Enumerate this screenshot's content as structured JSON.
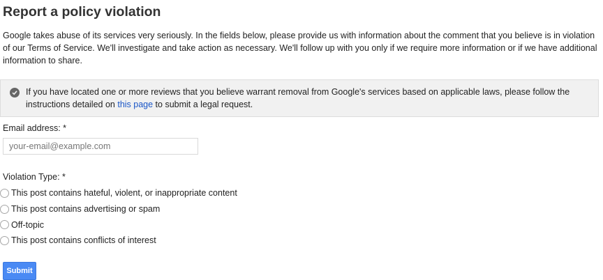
{
  "page": {
    "title": "Report a policy violation",
    "intro": "Google takes abuse of its services very seriously. In the fields below, please provide us with information about the comment that you believe is in violation of our Terms of Service. We'll investigate and take action as necessary. We'll follow up with you only if we require more information or if we have additional information to share."
  },
  "info": {
    "icon": "check-circle-icon",
    "text_before": "If you have located one or more reviews that you believe warrant removal from Google's services based on applicable laws, please follow the instructions detailed on ",
    "link_text": "this page",
    "text_after": " to submit a legal request."
  },
  "form": {
    "email_label": "Email address: *",
    "email_value": "",
    "email_placeholder": "your-email@example.com",
    "violation_label": "Violation Type: *",
    "options": [
      {
        "label": "This post contains hateful, violent, or inappropriate content",
        "selected": false
      },
      {
        "label": "This post contains advertising or spam",
        "selected": false
      },
      {
        "label": "Off-topic",
        "selected": false
      },
      {
        "label": "This post contains conflicts of interest",
        "selected": false
      }
    ],
    "submit_label": "Submit"
  },
  "colors": {
    "accent": "#4a8af4",
    "link": "#1a56c7",
    "info_bg": "#f1f1f1"
  }
}
